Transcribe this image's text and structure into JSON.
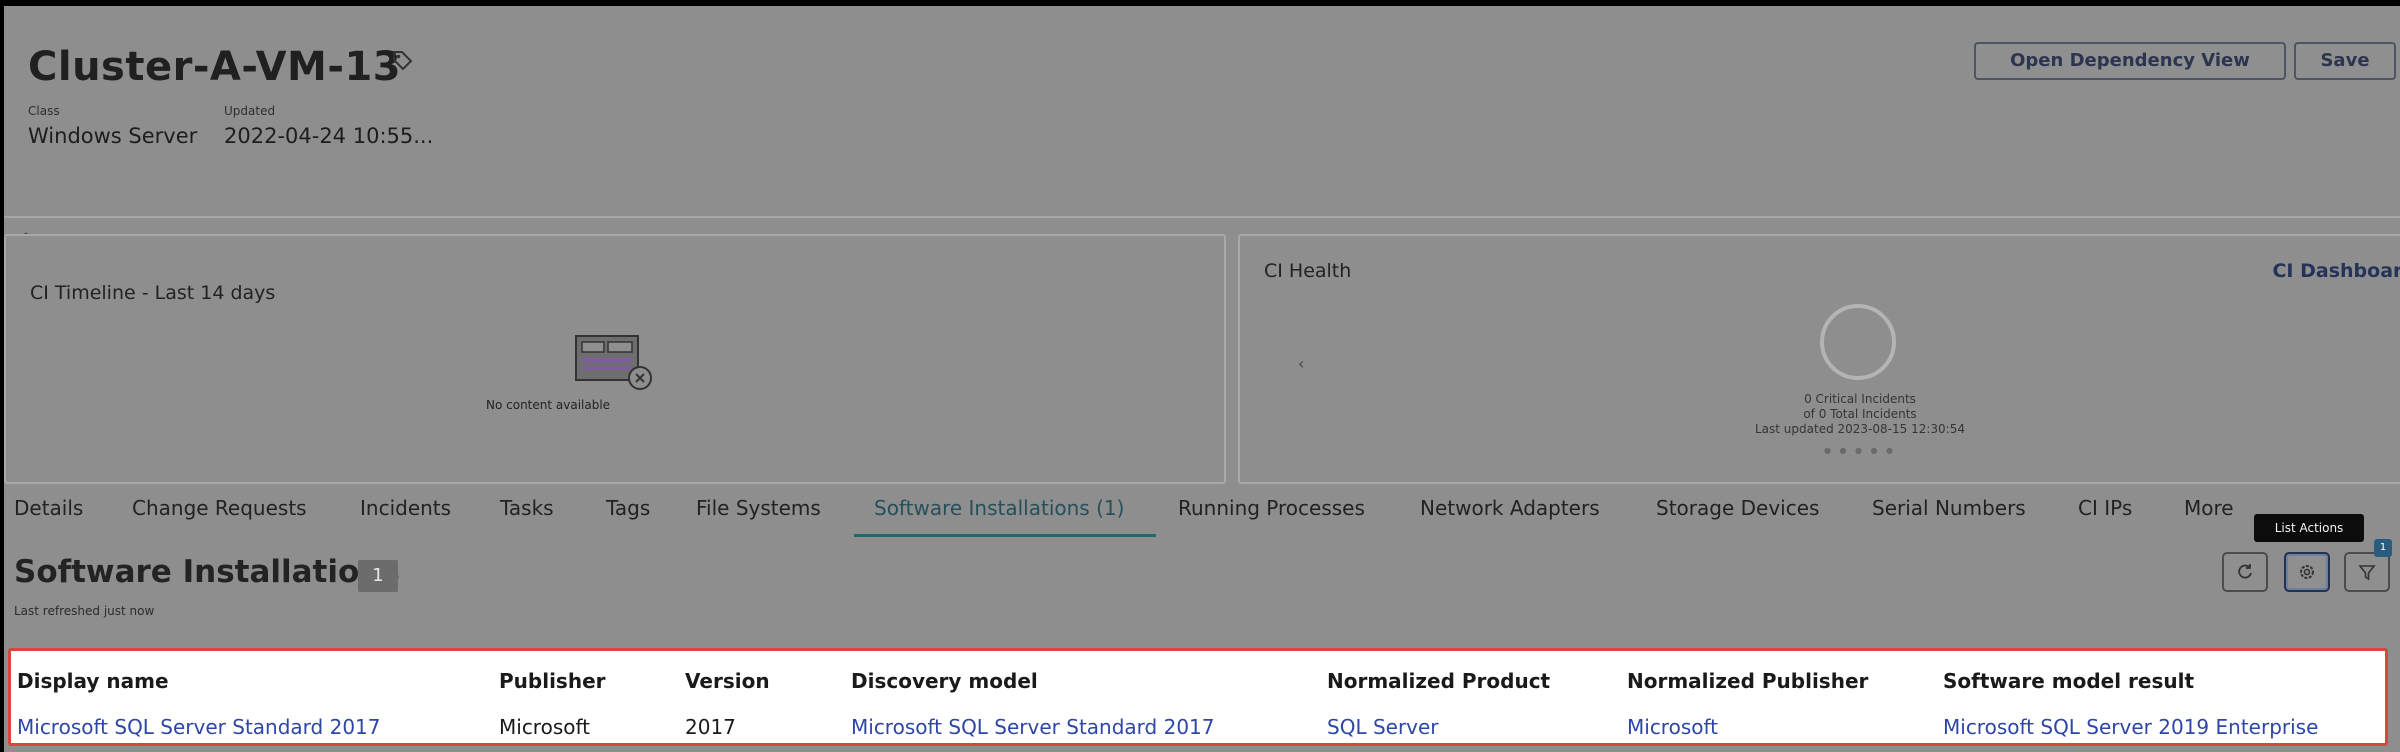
{
  "record": {
    "title": "Cluster-A-VM-13",
    "class_label": "Class",
    "class_value": "Windows Server",
    "updated_label": "Updated",
    "updated_value": "2022-04-24 10:55..."
  },
  "header_actions": {
    "open_dependency_view": "Open Dependency View",
    "save": "Save"
  },
  "timeline_panel": {
    "title": "CI Timeline - Last 14 days",
    "empty_text": "No content available"
  },
  "health_panel": {
    "title": "CI Health",
    "dashboard_link": "CI Dashboard",
    "critical_incidents": "0 Critical Incidents",
    "total_incidents": "of 0 Total Incidents",
    "last_updated": "Last updated 2023-08-15 12:30:54",
    "dots": "● ● ● ● ●"
  },
  "tabs": [
    {
      "label": "Details"
    },
    {
      "label": "Change Requests"
    },
    {
      "label": "Incidents"
    },
    {
      "label": "Tasks"
    },
    {
      "label": "Tags"
    },
    {
      "label": "File Systems"
    },
    {
      "label": "Software Installations (1)",
      "active": true
    },
    {
      "label": "Running Processes"
    },
    {
      "label": "Network Adapters"
    },
    {
      "label": "Storage Devices"
    },
    {
      "label": "Serial Numbers"
    },
    {
      "label": "CI IPs"
    },
    {
      "label": "More"
    }
  ],
  "tooltip": "List Actions",
  "section": {
    "title": "Software Installations",
    "count": "1",
    "refreshed": "Last refreshed just now",
    "filter_count": "1"
  },
  "table": {
    "columns": [
      "Display name",
      "Publisher",
      "Version",
      "Discovery model",
      "Normalized Product",
      "Normalized Publisher",
      "Software model result"
    ],
    "rows": [
      [
        "Microsoft SQL Server Standard 2017",
        "Microsoft",
        "2017",
        "Microsoft SQL Server Standard 2017",
        "SQL Server",
        "Microsoft",
        "Microsoft SQL Server 2019 Enterprise"
      ]
    ]
  },
  "icons": {
    "tag": "tag-icon",
    "collapse": "chevron-up-icon",
    "carousel_prev": "chevron-left-icon",
    "refresh": "refresh-icon",
    "settings": "gear-icon",
    "filter": "filter-icon",
    "empty_state": "empty-table-icon"
  }
}
